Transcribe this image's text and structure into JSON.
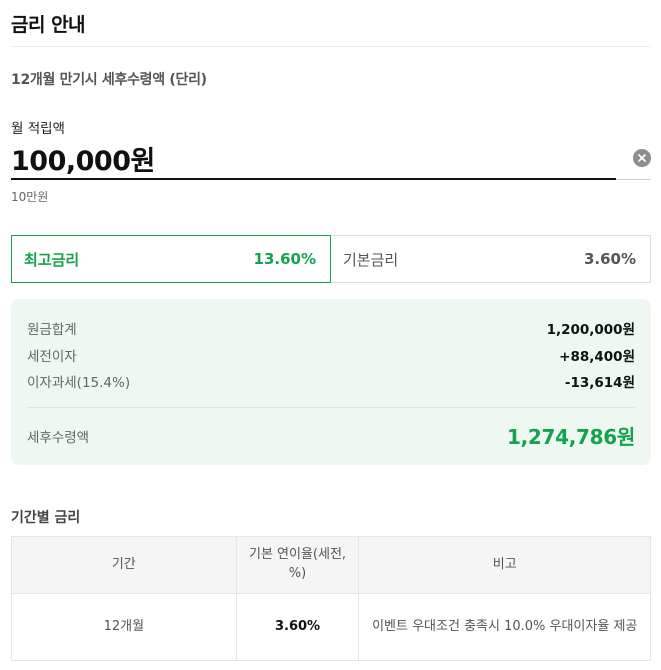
{
  "header": {
    "title": "금리 안내"
  },
  "subtitle": "12개월 만기시 세후수령액 (단리)",
  "amount": {
    "label": "월 적립액",
    "value": "100,000원",
    "hint": "10만원"
  },
  "rate_tabs": [
    {
      "label": "최고금리",
      "value": "13.60%",
      "selected": true
    },
    {
      "label": "기본금리",
      "value": "3.60%",
      "selected": false
    }
  ],
  "summary": {
    "rows": [
      {
        "label": "원금합계",
        "value": "1,200,000원"
      },
      {
        "label": "세전이자",
        "value": "+88,400원"
      },
      {
        "label": "이자과세(15.4%)",
        "value": "-13,614원"
      }
    ],
    "total": {
      "label": "세후수령액",
      "value": "1,274,786원"
    }
  },
  "period_rates": {
    "title": "기간별 금리",
    "headers": [
      "기간",
      "기본 연이율(세전, %)",
      "비고"
    ],
    "rows": [
      [
        "12개월",
        "3.60%",
        "이벤트 우대조건 충족시 10.0% 우대이자율 제공"
      ]
    ]
  },
  "colors": {
    "accent": "#13a34d",
    "summary_bg": "#eef7f0",
    "clear_button": "#8e8e8e"
  },
  "icons": {
    "clear": "close-circle-icon"
  }
}
